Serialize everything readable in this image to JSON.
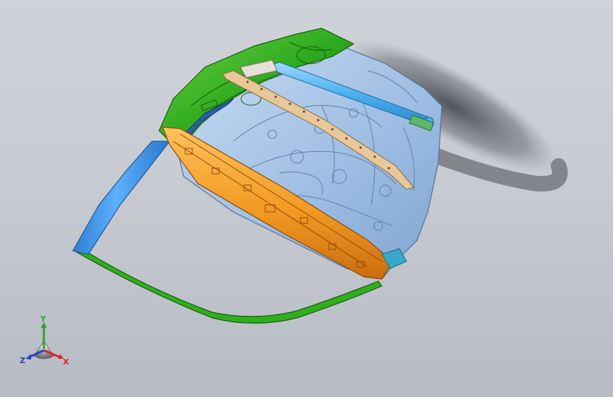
{
  "viewport": {
    "background_top": "#cfd2d8",
    "background_bottom": "#b7bbc4"
  },
  "model": {
    "parts": [
      {
        "name": "outer-frame",
        "color": "#2fae1e"
      },
      {
        "name": "inner-panel",
        "color": "#a8c8ec"
      },
      {
        "name": "reinforcement-beam",
        "color": "#f5a02a"
      },
      {
        "name": "upper-bar",
        "color": "#4fb2ef"
      },
      {
        "name": "window-pillar",
        "color": "#3a90dc"
      },
      {
        "name": "crossmember-rail",
        "color": "#e8c79a"
      }
    ]
  },
  "triad": {
    "x_label": "X",
    "y_label": "Y",
    "z_label": "Z",
    "x_color": "#d8262a",
    "y_color": "#2aa32a",
    "z_color": "#2642c8"
  }
}
